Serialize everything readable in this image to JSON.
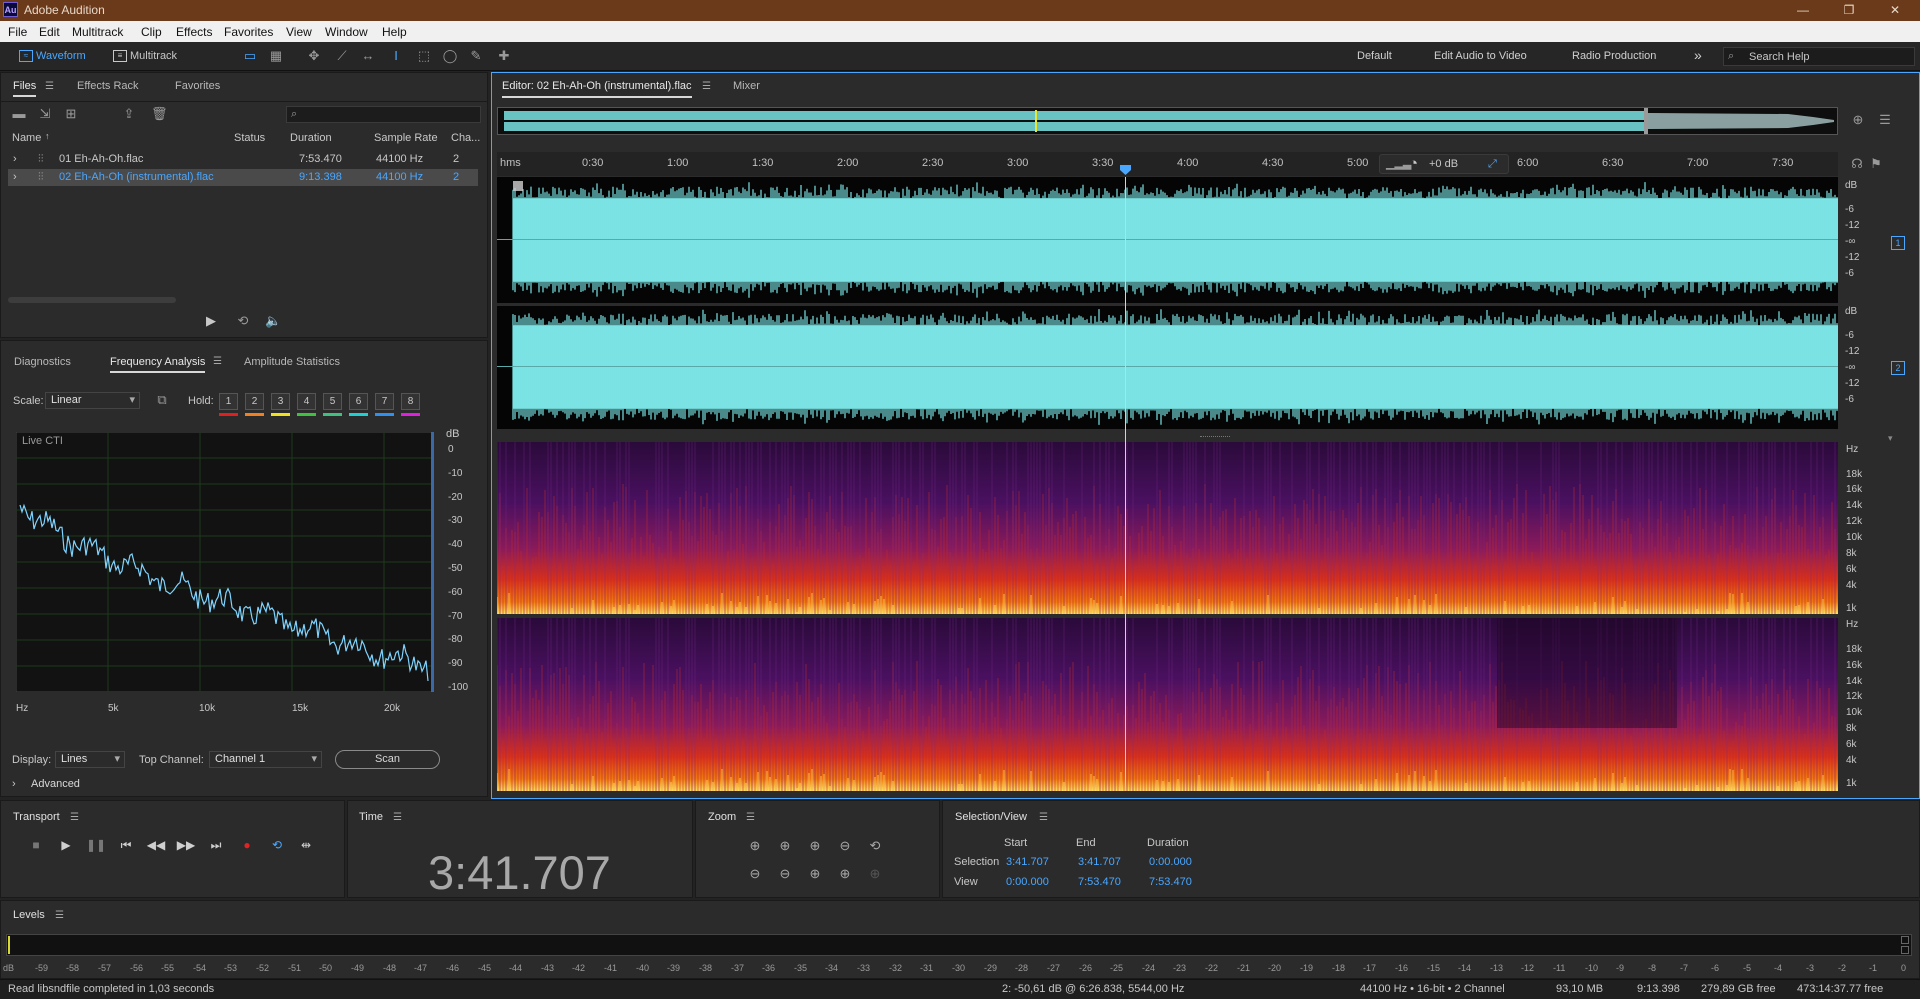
{
  "app": {
    "title": "Adobe Audition",
    "logo": "Au"
  },
  "menu": [
    "File",
    "Edit",
    "Multitrack",
    "Clip",
    "Effects",
    "Favorites",
    "View",
    "Window",
    "Help"
  ],
  "toolbar": {
    "waveform": "Waveform",
    "multitrack": "Multitrack",
    "workspaces": [
      "Default",
      "Edit Audio to Video",
      "Radio Production"
    ],
    "more": "»",
    "search_placeholder": "Search Help"
  },
  "files_panel": {
    "tabs": [
      "Files",
      "Effects Rack",
      "Favorites"
    ],
    "columns": [
      "Name",
      "Status",
      "Duration",
      "Sample Rate",
      "Cha..."
    ],
    "rows": [
      {
        "name": "01 Eh-Ah-Oh.flac",
        "status": "",
        "duration": "7:53.470",
        "rate": "44100 Hz",
        "ch": "2"
      },
      {
        "name": "02 Eh-Ah-Oh (instrumental).flac",
        "status": "",
        "duration": "9:13.398",
        "rate": "44100 Hz",
        "ch": "2"
      }
    ]
  },
  "analysis_panel": {
    "tabs": [
      "Diagnostics",
      "Frequency Analysis",
      "Amplitude Statistics"
    ],
    "scale_label": "Scale:",
    "scale_value": "Linear",
    "hold_label": "Hold:",
    "hold_buttons": [
      "1",
      "2",
      "3",
      "4",
      "5",
      "6",
      "7",
      "8"
    ],
    "hold_colors": [
      "#e02020",
      "#f08020",
      "#f0e020",
      "#40c040",
      "#40c080",
      "#20d0d0",
      "#3090f0",
      "#e020e0"
    ],
    "graph_title": "Live CTI",
    "db_unit": "dB",
    "db_ticks": [
      "0",
      "-10",
      "-20",
      "-30",
      "-40",
      "-50",
      "-60",
      "-70",
      "-80",
      "-90",
      "-100"
    ],
    "hz_ticks": [
      "Hz",
      "5k",
      "10k",
      "15k",
      "20k"
    ],
    "display_label": "Display:",
    "display_value": "Lines",
    "top_channel_label": "Top Channel:",
    "top_channel_value": "Channel 1",
    "scan_label": "Scan",
    "advanced_label": "Advanced"
  },
  "editor": {
    "tab_editor": "Editor: 02 Eh-Ah-Oh (instrumental).flac",
    "tab_mixer": "Mixer",
    "ruler_unit": "hms",
    "ruler_ticks": [
      "0:30",
      "1:00",
      "1:30",
      "2:00",
      "2:30",
      "3:00",
      "3:30",
      "4:00",
      "4:30",
      "5:00",
      "6:00",
      "6:30",
      "7:00",
      "7:30"
    ],
    "volume": "+0 dB",
    "wave_db": [
      "dB",
      "-6",
      "-12",
      "-∞",
      "-12",
      "-6"
    ],
    "channel_badges": [
      "1",
      "2"
    ],
    "spec_hz": [
      "Hz",
      "18k",
      "16k",
      "14k",
      "12k",
      "10k",
      "8k",
      "6k",
      "4k",
      "1k"
    ],
    "wave_color": "#7ae3e3"
  },
  "transport": {
    "title": "Transport"
  },
  "time": {
    "title": "Time",
    "value": "3:41.707"
  },
  "zoom": {
    "title": "Zoom"
  },
  "selection_view": {
    "title": "Selection/View",
    "headers": [
      "Start",
      "End",
      "Duration"
    ],
    "selection_label": "Selection",
    "selection": [
      "3:41.707",
      "3:41.707",
      "0:00.000"
    ],
    "view_label": "View",
    "view": [
      "0:00.000",
      "7:53.470",
      "7:53.470"
    ]
  },
  "levels": {
    "title": "Levels",
    "scale": [
      "dB",
      "-59",
      "-58",
      "-57",
      "-56",
      "-55",
      "-54",
      "-53",
      "-52",
      "-51",
      "-50",
      "-49",
      "-48",
      "-47",
      "-46",
      "-45",
      "-44",
      "-43",
      "-42",
      "-41",
      "-40",
      "-39",
      "-38",
      "-37",
      "-36",
      "-35",
      "-34",
      "-33",
      "-32",
      "-31",
      "-30",
      "-29",
      "-28",
      "-27",
      "-26",
      "-25",
      "-24",
      "-23",
      "-22",
      "-21",
      "-20",
      "-19",
      "-18",
      "-17",
      "-16",
      "-15",
      "-14",
      "-13",
      "-12",
      "-11",
      "-10",
      "-9",
      "-8",
      "-7",
      "-6",
      "-5",
      "-4",
      "-3",
      "-2",
      "-1",
      "0"
    ]
  },
  "status": {
    "left": "Read libsndfile completed in 1,03 seconds",
    "cursor": "2: -50,61 dB @ 6:26.838, 5544,00 Hz",
    "format": "44100 Hz • 16-bit • 2 Channel",
    "size": "93,10 MB",
    "duration": "9:13.398",
    "free": "279,89 GB free",
    "free_time": "473:14:37.77 free"
  }
}
